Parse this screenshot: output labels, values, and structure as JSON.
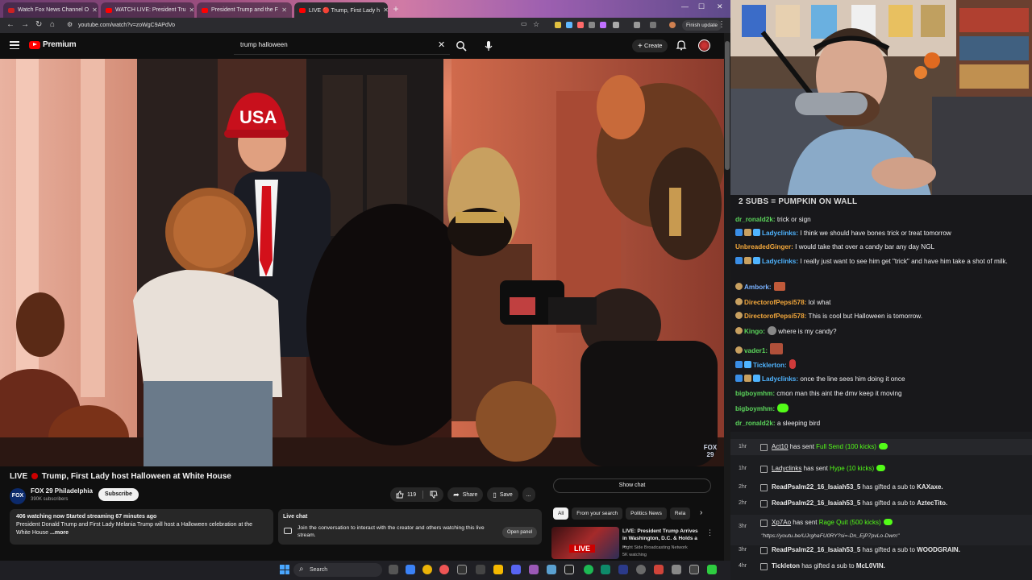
{
  "browser": {
    "tabs": [
      {
        "label": "Watch Fox News Channel O"
      },
      {
        "label": "WATCH LIVE: President Tru"
      },
      {
        "label": "President Trump and the F"
      },
      {
        "label": "LIVE 🔴 Trump, First Lady h"
      }
    ],
    "url": "youtube.com/watch?v=zoWgC9APdVo",
    "finish_update": "Finish update"
  },
  "yt": {
    "brand": "Premium",
    "search_value": "trump halloween",
    "create_label": "Create",
    "video": {
      "title_prefix": "LIVE",
      "title": "Trump, First Lady host Halloween at White House",
      "channel": "FOX 29 Philadelphia",
      "channel_logo": "FOX 29",
      "subscribers": "390K subscribers",
      "subscribe": "Subscribe",
      "likes": "119",
      "share": "Share",
      "save": "Save",
      "more": "...",
      "bug": "FOX 29",
      "usa_hat": "USA"
    },
    "description": {
      "watching_count": "406",
      "meta": "watching now  Started streaming 67 minutes ago",
      "text": "President Donald Trump and First Lady Melania Trump will host a Halloween celebration at the White House",
      "more": " ...more"
    },
    "live_chat": {
      "title": "Live chat",
      "text": "Join the conversation to interact with the creator and others watching this live stream.",
      "open_panel": "Open panel",
      "show_chat": "Show chat"
    },
    "chips": [
      "All",
      "From your search",
      "Politics News",
      "Rela"
    ],
    "recommendation": {
      "badge": "LIVE",
      "title": "LIVE: President Trump Arrives in Washington, D.C. & Holds a ...",
      "channel": "Right Side Broadcasting Network",
      "watching": "5K watching"
    }
  },
  "taskbar": {
    "search": "Search"
  },
  "stream": {
    "overlay_text": "2 SUBS = PUMPKIN ON WALL"
  },
  "chat": [
    {
      "user": "dr_ronald2k:",
      "text": " trick or sign",
      "color": "#5bd45b"
    },
    {
      "user": "Ladyclinks:",
      "text": " I think we should have bones trick or treat tomorrow",
      "color": "#4fb4ff"
    },
    {
      "user": "UnbreadedGinger:",
      "text": " I would take that over a candy bar any day NGL",
      "color": "#f2a73b"
    },
    {
      "user": "Ladyclinks:",
      "text": " I really just want to see him get \"trick\" and have him take a shot of milk.",
      "color": "#4fb4ff"
    },
    {
      "user": "Ambork:",
      "text": "",
      "color": "#7ab2ff"
    },
    {
      "user": "DirectorofPepsi578:",
      "text": " lol what",
      "color": "#f2a73b"
    },
    {
      "user": "DirectorofPepsi578:",
      "text": " This is cool but Halloween is tomorrow.",
      "color": "#f2a73b"
    },
    {
      "user": "Kingo:",
      "text": " where is my candy?",
      "color": "#5bd45b"
    },
    {
      "user": "vader1:",
      "text": "",
      "color": "#5bd45b"
    },
    {
      "user": "Ticklerton:",
      "text": "",
      "color": "#4fb4ff"
    },
    {
      "user": "Ladyclinks:",
      "text": " once the line sees him doing it once",
      "color": "#4fb4ff"
    },
    {
      "user": "bigboymhm:",
      "text": " cmon man this aint the dmv keep it moving",
      "color": "#5bd45b"
    },
    {
      "user": "bigboymhm:",
      "text": "",
      "color": "#5bd45b"
    },
    {
      "user": "dr_ronald2k:",
      "text": " a sleeping bird",
      "color": "#5bd45b"
    }
  ],
  "events": [
    {
      "time": "1hr",
      "user": "Act10",
      "mid": " has sent ",
      "item": "Full Send (100 kicks)"
    },
    {
      "time": "1hr",
      "user": "Ladyclinks",
      "mid": " has sent ",
      "item": "Hype (10 kicks)"
    },
    {
      "time": "2hr",
      "user": "ReadPsalm22_16_Isaiah53_5",
      "mid": " has gifted a sub to ",
      "item": "KAXaxe."
    },
    {
      "time": "2hr",
      "user": "ReadPsalm22_16_Isaiah53_5",
      "mid": " has gifted a sub to ",
      "item": "AztecTito."
    },
    {
      "time": "3hr",
      "user": "Xp7Ao",
      "mid": " has sent ",
      "item": "Rage Quit (500 kicks)"
    },
    {
      "time": "3hr",
      "user": "ReadPsalm22_16_Isaiah53_5",
      "mid": " has gifted a sub to ",
      "item": "WOODGRAIN."
    },
    {
      "time": "4hr",
      "user": "Tickleton",
      "mid": " has gifted a sub to ",
      "item": "McL0VIN."
    }
  ],
  "event_link": "\"https://youtu.be/UJrghaFU0RY?si=-Dn_EjP7pvLo-Dwm\""
}
